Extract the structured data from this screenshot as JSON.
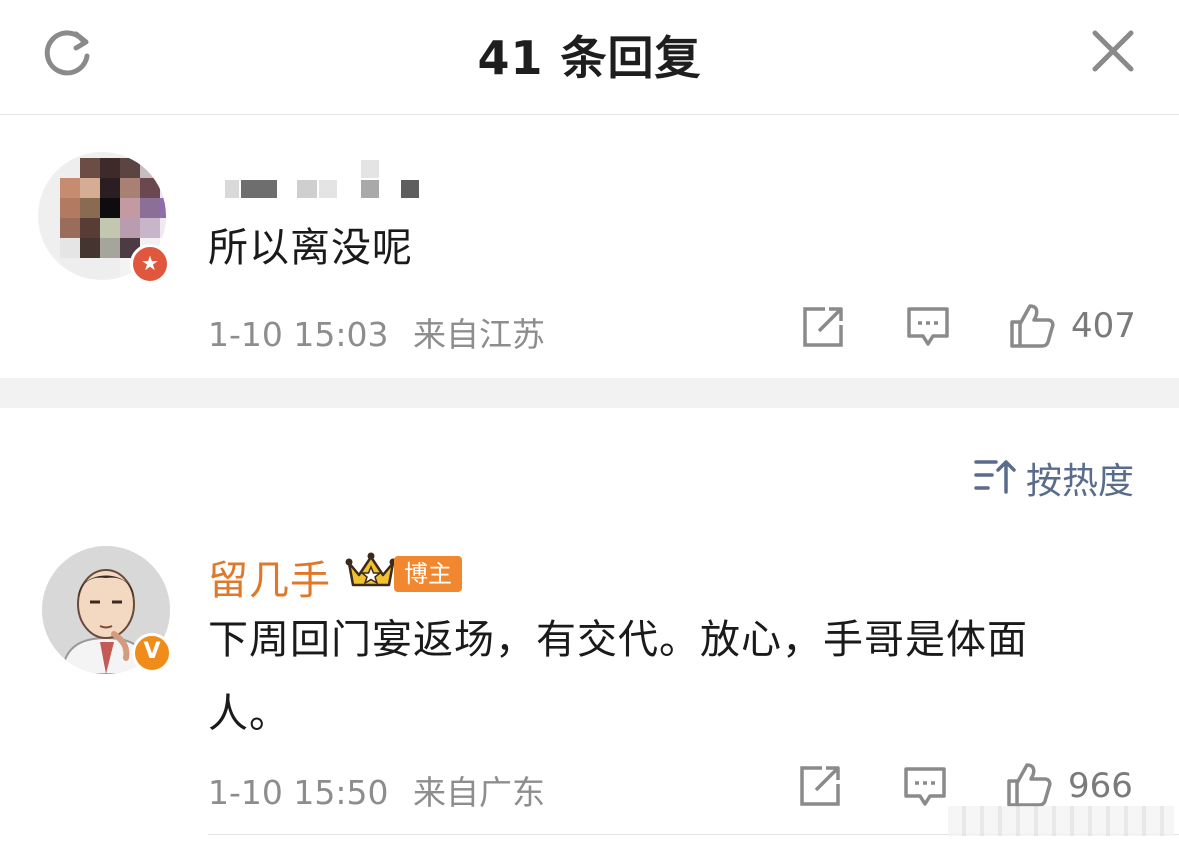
{
  "header": {
    "title": "41 条回复"
  },
  "comments": [
    {
      "text": "所以离没呢",
      "time": "1-10 15:03",
      "source": "来自江苏",
      "likes": "407"
    },
    {
      "author": "留几手",
      "author_tag": "博主",
      "text_line1": "下周回门宴返场，有交代。放心，手哥是体面",
      "text_line2": "人。",
      "time": "1-10 15:50",
      "source": "来自广东",
      "likes": "966"
    }
  ],
  "sort": {
    "label": "按热度"
  },
  "colors": {
    "accent_orange": "#e07829",
    "sort_blue": "#5a6c8c",
    "meta_gray": "#8d8d8d"
  },
  "icons": [
    "refresh-icon",
    "close-icon",
    "share-icon",
    "comment-icon",
    "like-icon",
    "sort-icon",
    "crown-icon"
  ]
}
